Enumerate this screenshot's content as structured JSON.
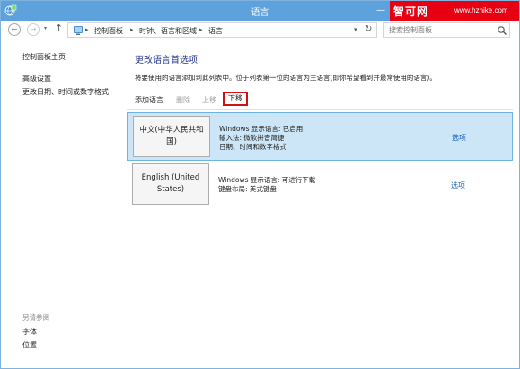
{
  "window": {
    "title": "语言",
    "watermark_brand": "智可网",
    "watermark_url": "www.hzhike.com",
    "min_glyph": "—",
    "max_glyph": "□"
  },
  "address": {
    "back_glyph": "←",
    "forward_glyph": "→",
    "up_glyph": "↑",
    "breadcrumbs": [
      "控制面板",
      "时钟、语言和区域",
      "语言"
    ],
    "separator": "▸",
    "dropdown_glyph": "▾",
    "refresh_glyph": "↻"
  },
  "search": {
    "placeholder": "搜索控制面板"
  },
  "sidebar": {
    "items": [
      {
        "label": "控制面板主页"
      },
      {
        "label": "高级设置"
      },
      {
        "label": "更改日期、时间或数字格式"
      }
    ],
    "see_also_heading": "另请参阅",
    "see_also": [
      {
        "label": "字体"
      },
      {
        "label": "位置"
      }
    ]
  },
  "main": {
    "title": "更改语言首选项",
    "description": "将要使用的语言添加到此列表中。位于列表第一位的语言为主语言(即你希望看到并最常使用的语言)。"
  },
  "toolbar": {
    "add_label": "添加语言",
    "remove_label": "删除",
    "move_up_label": "上移",
    "move_down_label": "下移"
  },
  "languages": [
    {
      "tile_label": "中文(中华人民共和国)",
      "selected": true,
      "lines": [
        "Windows 显示语言: 已启用",
        "输入法: 微软拼音简捷",
        "日期、时间和数字格式"
      ],
      "options_label": "选项"
    },
    {
      "tile_label": "English (United States)",
      "selected": false,
      "lines": [
        "Windows 显示语言: 可进行下载",
        "键盘布局: 美式键盘"
      ],
      "options_label": "选项"
    }
  ],
  "colors": {
    "titlebar": "#5da2dd",
    "selected_row": "#cde6f7",
    "selected_border": "#6fb2e6",
    "link": "#1a5fb4",
    "title_text": "#1e3287",
    "highlight_box": "#d01010",
    "watermark_bg": "#e60012"
  }
}
